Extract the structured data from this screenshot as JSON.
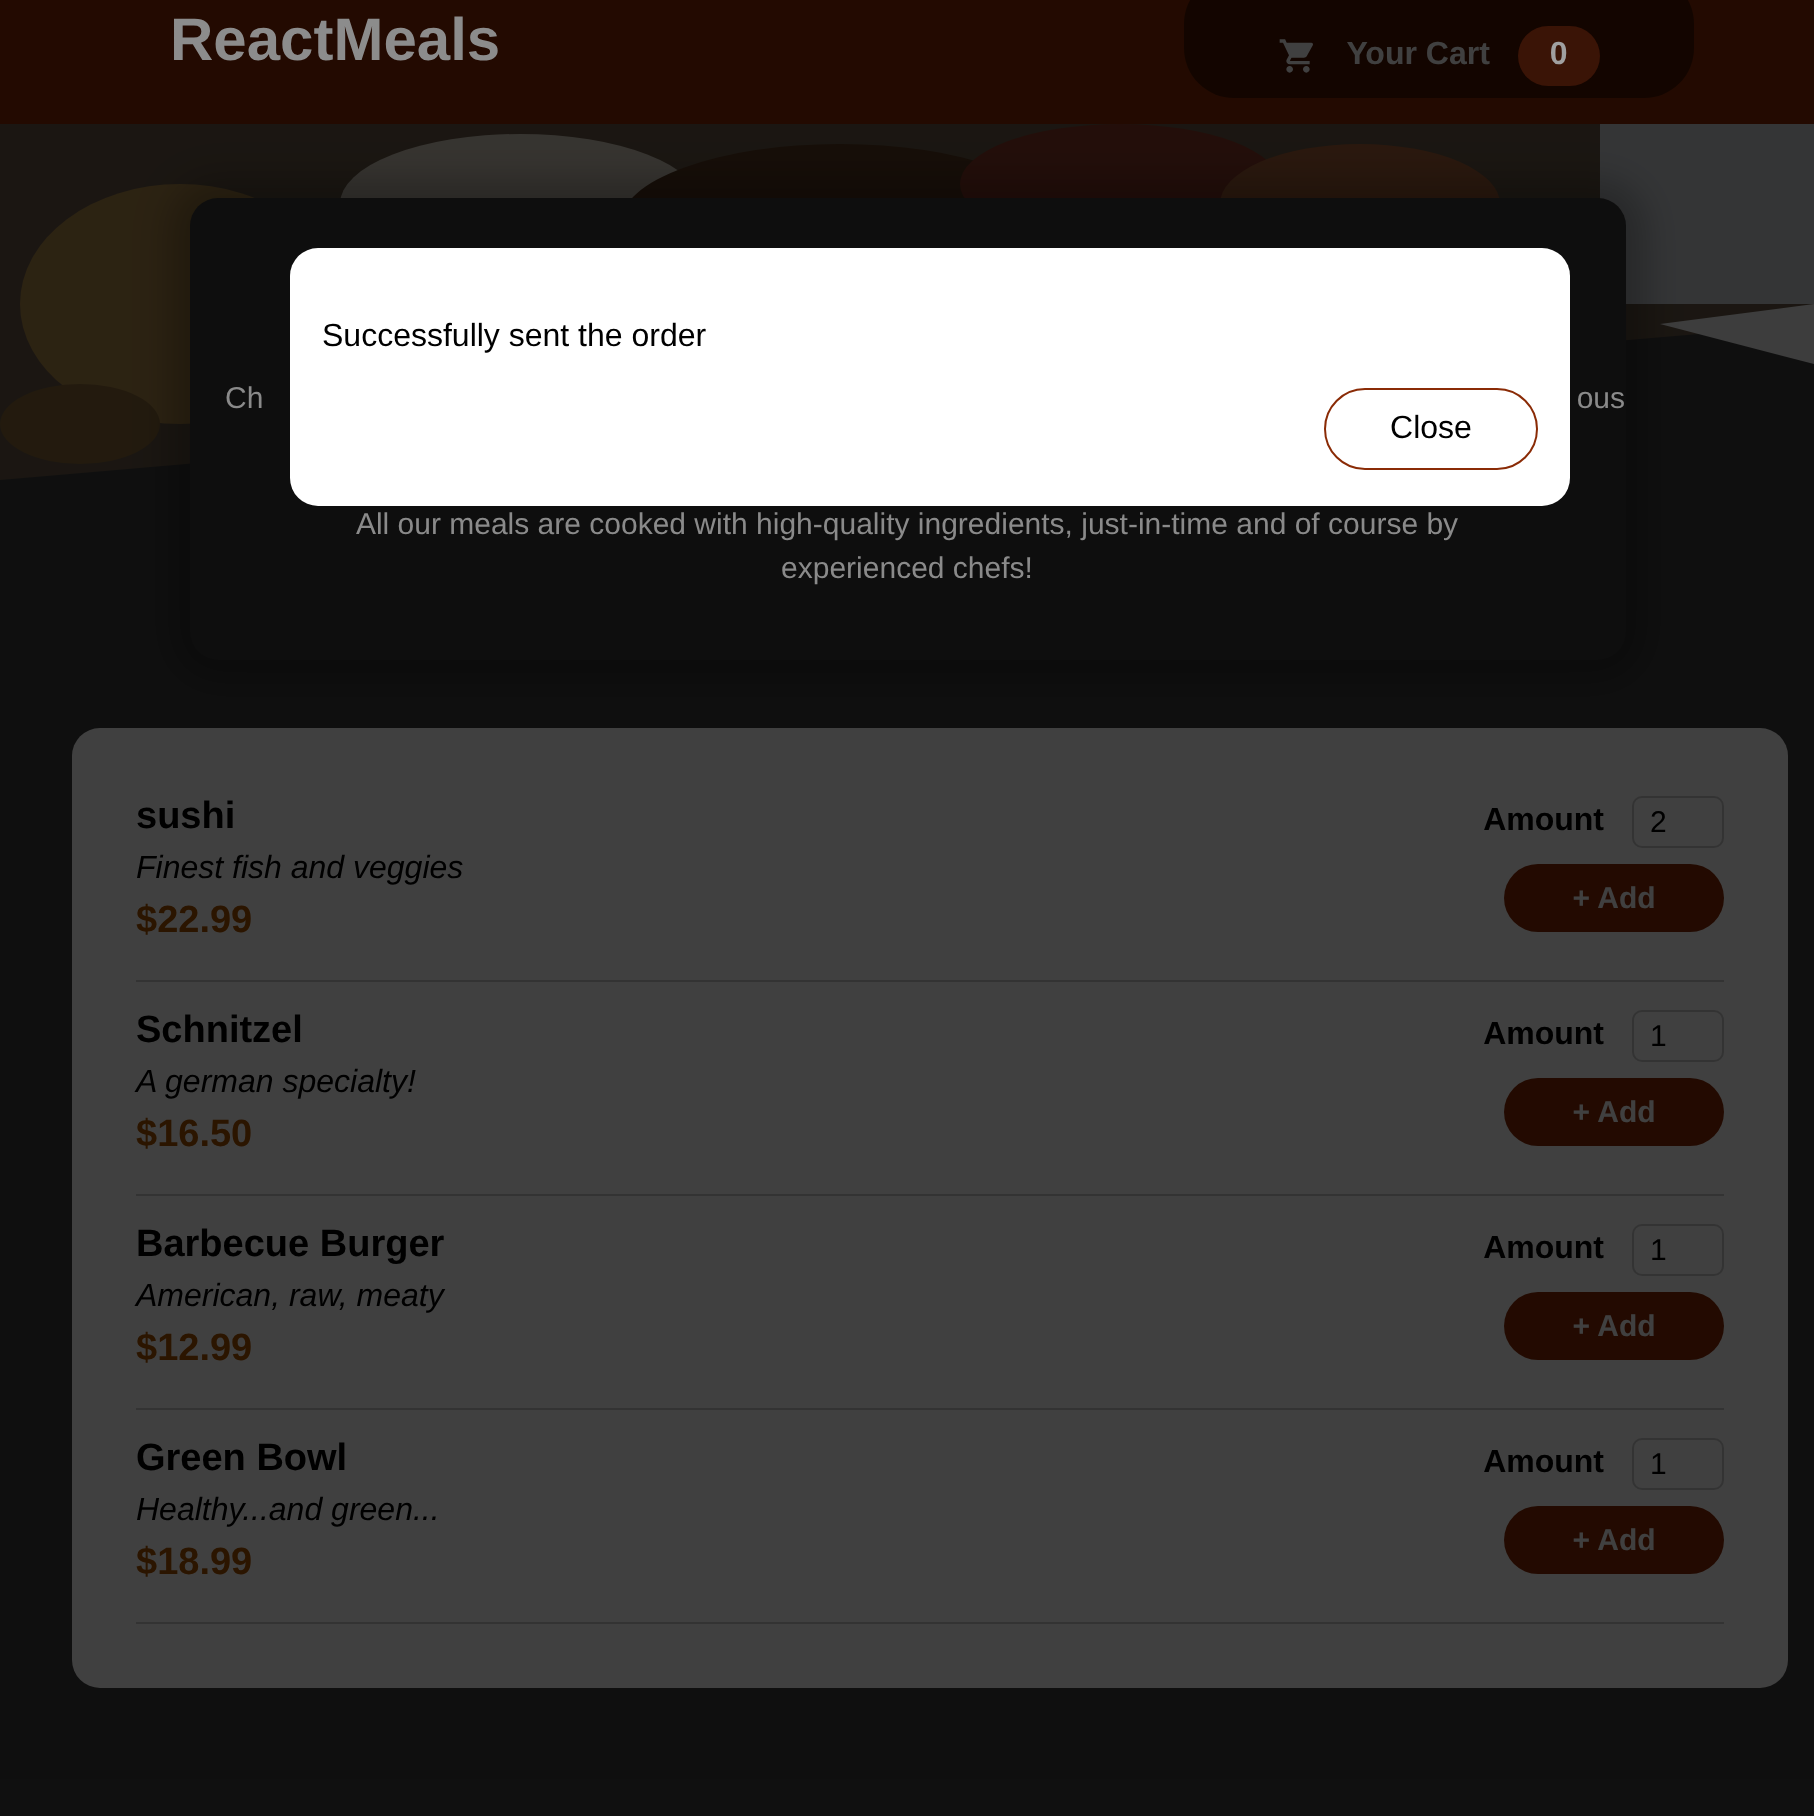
{
  "header": {
    "title": "ReactMeals",
    "cart_button": {
      "label": "Your Cart",
      "badge": "0"
    }
  },
  "summary": {
    "covered_line_start": "Ch",
    "covered_line_end": "ous",
    "paragraph": "All our meals are cooked with high-quality ingredients, just-in-time and of course by experienced chefs!"
  },
  "meals": [
    {
      "name": "sushi",
      "description": "Finest fish and veggies",
      "price": "$22.99",
      "amount_label": "Amount",
      "amount": "2",
      "add_button": "+ Add"
    },
    {
      "name": "Schnitzel",
      "description": "A german specialty!",
      "price": "$16.50",
      "amount_label": "Amount",
      "amount": "1",
      "add_button": "+ Add"
    },
    {
      "name": "Barbecue Burger",
      "description": "American, raw, meaty",
      "price": "$12.99",
      "amount_label": "Amount",
      "amount": "1",
      "add_button": "+ Add"
    },
    {
      "name": "Green Bowl",
      "description": "Healthy...and green...",
      "price": "$18.99",
      "amount_label": "Amount",
      "amount": "1",
      "add_button": "+ Add"
    }
  ],
  "modal": {
    "message": "Successfully sent the order",
    "close_button": "Close"
  }
}
